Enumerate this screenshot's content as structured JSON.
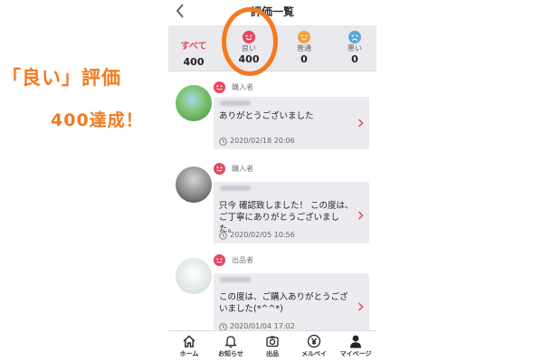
{
  "caption": {
    "line1": "「良い」評価",
    "line2": "400達成！"
  },
  "nav": {
    "title": "評価一覧"
  },
  "tabs": [
    {
      "label": "すべて",
      "count": "400"
    },
    {
      "label": "良い",
      "count": "400",
      "icon": "smile-icon"
    },
    {
      "label": "普通",
      "count": "0",
      "icon": "neutral-face-icon"
    },
    {
      "label": "悪い",
      "count": "0",
      "icon": "sad-face-icon"
    }
  ],
  "reviews": [
    {
      "role": "購入者",
      "comment": "ありがとうございました",
      "datetime": "2020/02/18 20:06"
    },
    {
      "role": "購入者",
      "comment": "只今 確認致しました！ この度は、ご丁寧にありがとうございました。",
      "datetime": "2020/02/05 10:56"
    },
    {
      "role": "出品者",
      "comment": "この度は、ご購入ありがとうございました(*^^*)",
      "datetime": "2020/01/04 17:02"
    }
  ],
  "tabbar": [
    {
      "label": "ホーム",
      "icon": "home-icon"
    },
    {
      "label": "お知らせ",
      "icon": "bell-icon"
    },
    {
      "label": "出品",
      "icon": "camera-icon"
    },
    {
      "label": "メルペイ",
      "icon": "yen-icon"
    },
    {
      "label": "マイページ",
      "icon": "person-icon"
    }
  ],
  "colors": {
    "accent_orange": "#f47a20",
    "good": "#e6475e",
    "normal": "#f0a23c",
    "bad": "#5aa7d6"
  }
}
